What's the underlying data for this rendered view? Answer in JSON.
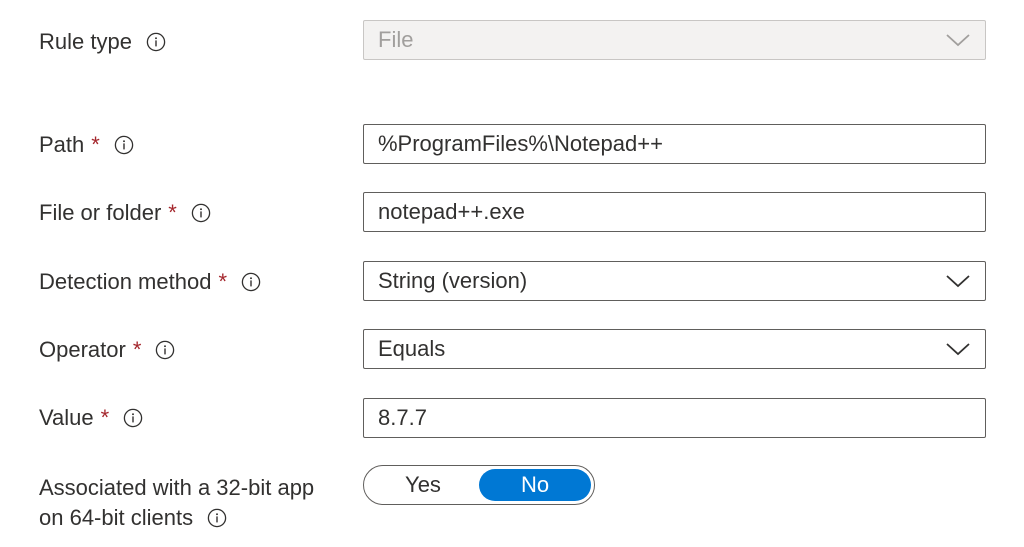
{
  "rule_type": {
    "label": "Rule type",
    "value": "File"
  },
  "path": {
    "label": "Path",
    "required_mark": "*",
    "value": "%ProgramFiles%\\Notepad++"
  },
  "file_or_folder": {
    "label": "File or folder",
    "required_mark": "*",
    "value": "notepad++.exe"
  },
  "detection_method": {
    "label": "Detection method",
    "required_mark": "*",
    "value": "String (version)"
  },
  "operator": {
    "label": "Operator",
    "required_mark": "*",
    "value": "Equals"
  },
  "value_field": {
    "label": "Value",
    "required_mark": "*",
    "value": "8.7.7"
  },
  "associated_32bit": {
    "label_line1": "Associated with a 32-bit app",
    "label_line2": "on 64-bit clients",
    "options": [
      "Yes",
      "No"
    ],
    "selected": "No"
  },
  "colors": {
    "accent": "#0078d4",
    "required": "#a4262c",
    "border": "#605e5c",
    "disabled_bg": "#f3f2f1",
    "disabled_text": "#a19f9d"
  },
  "icons": {
    "info": "info-icon",
    "dropdown": "chevron-down-icon"
  }
}
